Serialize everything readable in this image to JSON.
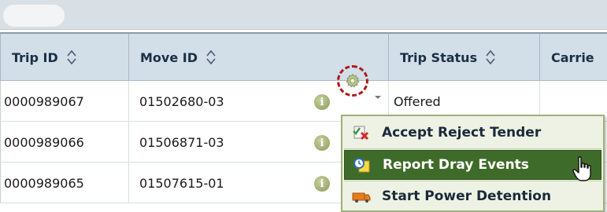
{
  "columns": [
    {
      "label": "Trip ID",
      "sortable": true
    },
    {
      "label": "Move ID",
      "sortable": true
    },
    {
      "label": "",
      "sortable": false
    },
    {
      "label": "Trip Status",
      "sortable": true
    },
    {
      "label": "Carrie",
      "sortable": false
    }
  ],
  "rows": [
    {
      "trip_id": "0000989067",
      "move_id": "01502680-03",
      "status": "Offered"
    },
    {
      "trip_id": "0000989066",
      "move_id": "01506871-03",
      "status": ""
    },
    {
      "trip_id": "0000989065",
      "move_id": "01507615-01",
      "status": ""
    }
  ],
  "info_icon_glyph": "i",
  "menu": {
    "items": [
      {
        "label": "Accept Reject Tender",
        "icon": "tender-icon",
        "highlighted": false
      },
      {
        "label": "Report Dray Events",
        "icon": "report-icon",
        "highlighted": true
      },
      {
        "label": "Start Power Detention",
        "icon": "truck-icon",
        "highlighted": false
      }
    ]
  },
  "colors": {
    "header_bg": "#d2dee8",
    "menu_bg": "#eef2e4",
    "menu_highlight": "#3f6b2a",
    "gear_circle": "#b01818"
  }
}
